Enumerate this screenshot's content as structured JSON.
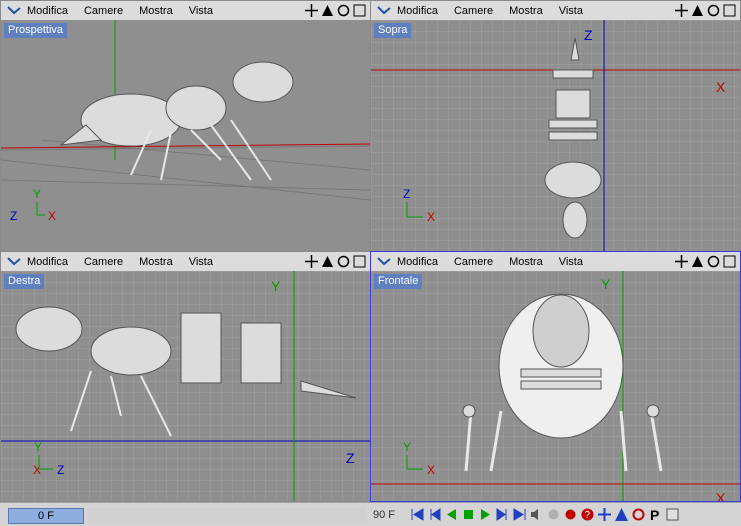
{
  "menu": {
    "modifica": "Modifica",
    "camere": "Camere",
    "mostra": "Mostra",
    "vista": "Vista"
  },
  "viewports": {
    "tl": {
      "label": "Prospettiva"
    },
    "tr": {
      "label": "Sopra",
      "axis1": "Z",
      "axis2": "X"
    },
    "bl": {
      "label": "Destra",
      "axis1": "Y",
      "axis2": "Z"
    },
    "br": {
      "label": "Frontale",
      "axis1": "Y",
      "axis2": "X"
    }
  },
  "gizmo": {
    "x": "X",
    "y": "Y",
    "z": "Z"
  },
  "timeline": {
    "current_frame": "0 F",
    "end_frame": "90 F"
  },
  "colors": {
    "view_bg": "#8f8f8f",
    "grid": "#a2a2a2",
    "x_axis": "#c00000",
    "y_axis": "#00a000",
    "z_axis": "#0000c0",
    "label_bg": "#5f7fbf"
  }
}
